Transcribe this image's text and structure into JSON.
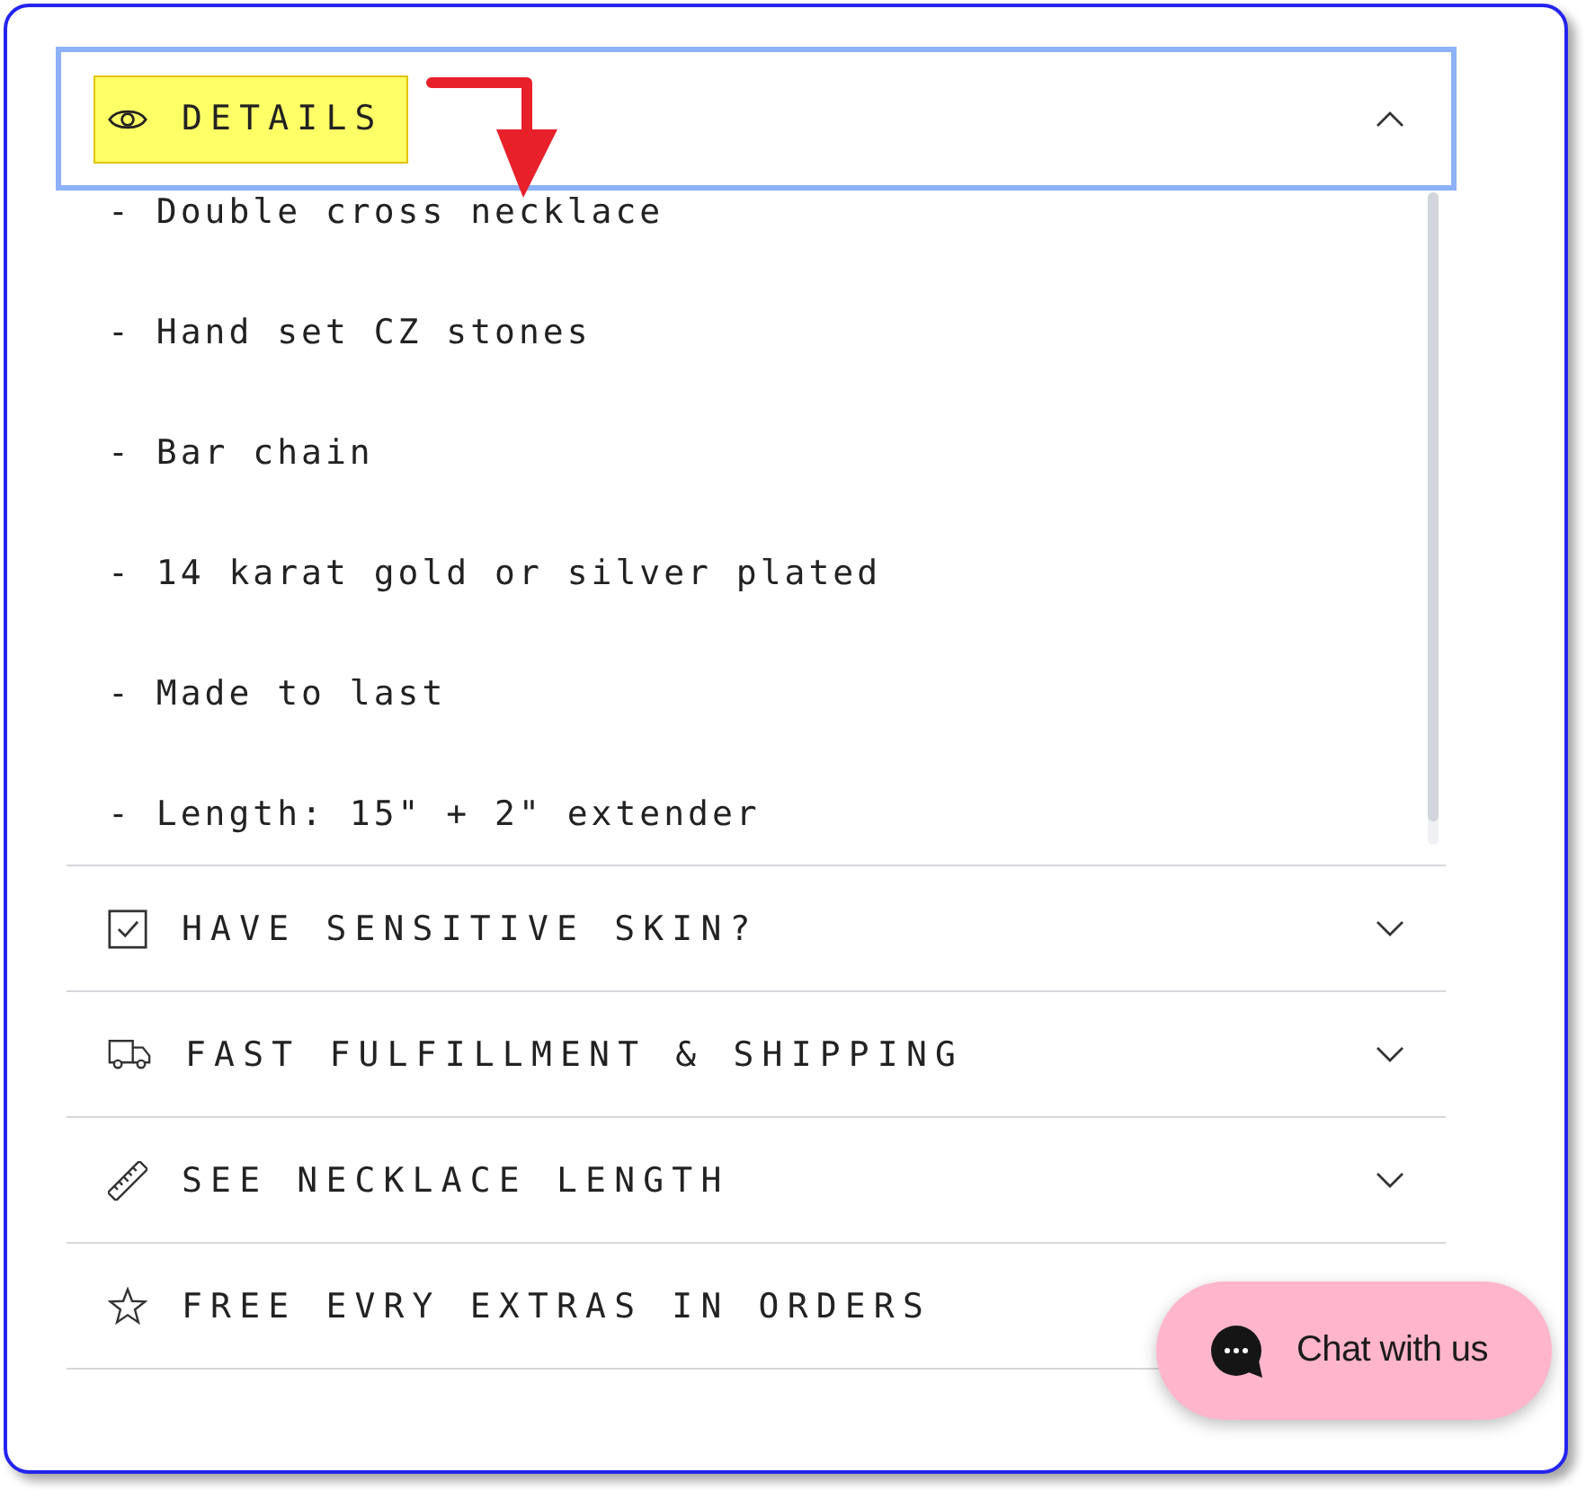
{
  "details": {
    "title": "DETAILS",
    "expanded": true,
    "focused": true,
    "highlighted": true,
    "items": [
      "- Double cross necklace",
      "- Hand set CZ stones",
      "- Bar chain",
      "- 14 karat gold or silver plated",
      "- Made to last",
      "- Length: 15\" + 2\" extender"
    ]
  },
  "sections": [
    {
      "title": "HAVE SENSITIVE SKIN?",
      "expanded": false
    },
    {
      "title": "FAST FULFILLMENT & SHIPPING",
      "expanded": false
    },
    {
      "title": "SEE NECKLACE LENGTH",
      "expanded": false
    },
    {
      "title": "FREE EVRY EXTRAS IN ORDERS"
    }
  ],
  "chat_button": {
    "label": "Chat with us"
  }
}
